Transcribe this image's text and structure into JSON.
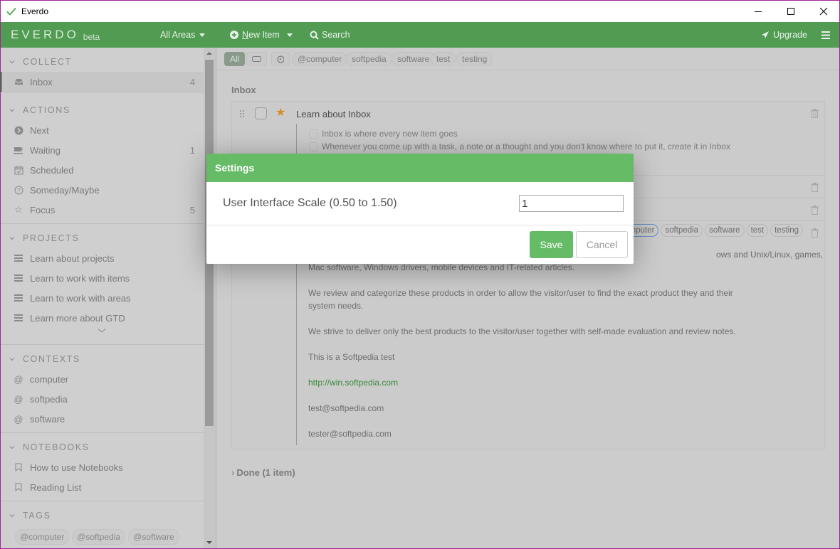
{
  "window": {
    "title": "Everdo",
    "controls": {
      "minimize": "minimize-icon",
      "maximize": "maximize-icon",
      "close": "close-icon"
    }
  },
  "topbar": {
    "logo": "EVERDO",
    "badge": "beta",
    "areas": "All Areas",
    "new_item_prefix": "N",
    "new_item_rest": "ew Item",
    "search": "Search",
    "upgrade": "Upgrade",
    "menu_icon": "hamburger-icon"
  },
  "sidebar": {
    "collect": {
      "title": "COLLECT",
      "items": [
        {
          "label": "Inbox",
          "count": "4",
          "icon": "inbox-icon"
        }
      ]
    },
    "actions": {
      "title": "ACTIONS",
      "items": [
        {
          "label": "Next",
          "count": "",
          "icon": "next-icon"
        },
        {
          "label": "Waiting",
          "count": "1",
          "icon": "waiting-icon"
        },
        {
          "label": "Scheduled",
          "count": "",
          "icon": "calendar-icon"
        },
        {
          "label": "Someday/Maybe",
          "count": "",
          "icon": "question-icon"
        },
        {
          "label": "Focus",
          "count": "5",
          "icon": "star-icon"
        }
      ]
    },
    "projects": {
      "title": "PROJECTS",
      "items": [
        {
          "label": "Learn about projects"
        },
        {
          "label": "Learn to work with items"
        },
        {
          "label": "Learn to work with areas"
        },
        {
          "label": "Learn more about GTD"
        }
      ]
    },
    "contexts": {
      "title": "CONTEXTS",
      "items": [
        {
          "label": "computer"
        },
        {
          "label": "softpedia"
        },
        {
          "label": "software"
        }
      ]
    },
    "notebooks": {
      "title": "NOTEBOOKS",
      "items": [
        {
          "label": "How to use Notebooks"
        },
        {
          "label": "Reading List"
        }
      ]
    },
    "tags": {
      "title": "TAGS",
      "items": [
        "@computer",
        "@softpedia",
        "@software"
      ]
    }
  },
  "filterbar": {
    "all": "All",
    "tags": [
      "@computer",
      "softpedia",
      "software",
      "test",
      "testing"
    ]
  },
  "main": {
    "section_title": "Inbox",
    "item1": {
      "title": "Learn about Inbox",
      "subitems": [
        "Inbox is where every new item goes",
        "Whenever you come up with a task, a note or a thought and you don't know where to put it, create it in Inbox"
      ]
    },
    "item4": {
      "tags": [
        "omputer",
        "softpedia",
        "software",
        "test",
        "testing"
      ],
      "notes": [
        "ows and Unix/Linux, games,",
        "Mac software, Windows drivers, mobile devices and IT-related articles.",
        "We review and categorize these products in order to allow the visitor/user to find the exact product they and their",
        "system needs.",
        "We strive to deliver only the best products to the visitor/user together with self-made evaluation and review notes.",
        "This is a Softpedia test",
        "http://win.softpedia.com",
        "test@softpedia.com",
        "tester@softpedia.com"
      ]
    },
    "done": "Done  (1 item)"
  },
  "modal": {
    "title": "Settings",
    "label": "User Interface Scale (0.50 to 1.50)",
    "value": "1",
    "save": "Save",
    "cancel": "Cancel"
  },
  "colors": {
    "brand_green": "#519b52",
    "modal_green": "#66bb67",
    "star": "#d98a2b",
    "link": "#3a8a3b"
  }
}
